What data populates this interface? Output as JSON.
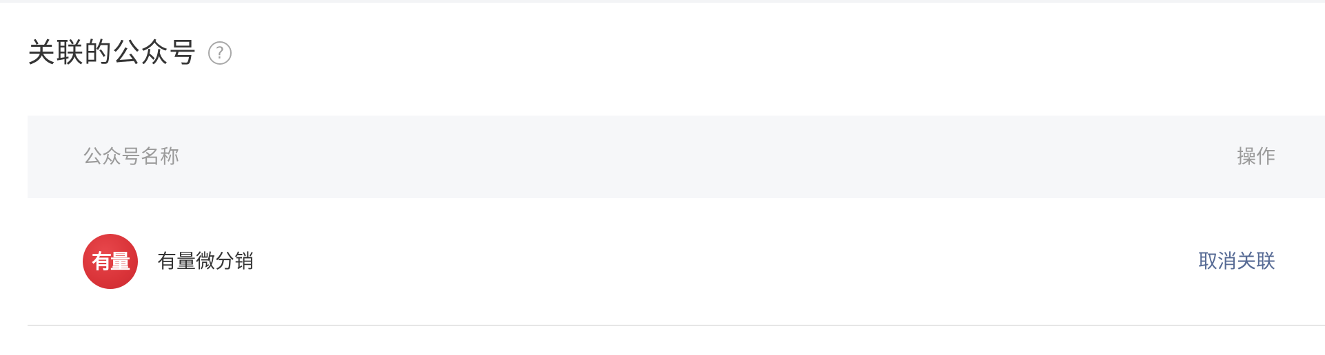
{
  "section": {
    "title": "关联的公众号",
    "help_icon": "question-mark-icon",
    "help_symbol": "?"
  },
  "table": {
    "columns": {
      "name": "公众号名称",
      "action": "操作"
    },
    "rows": [
      {
        "avatar_text": "有量",
        "avatar_color": "#d93338",
        "name": "有量微分销",
        "action_label": "取消关联"
      }
    ]
  },
  "colors": {
    "link": "#576b95",
    "header_bg": "#f6f7f9",
    "text_primary": "#353535",
    "text_secondary": "#9b9b9b"
  }
}
